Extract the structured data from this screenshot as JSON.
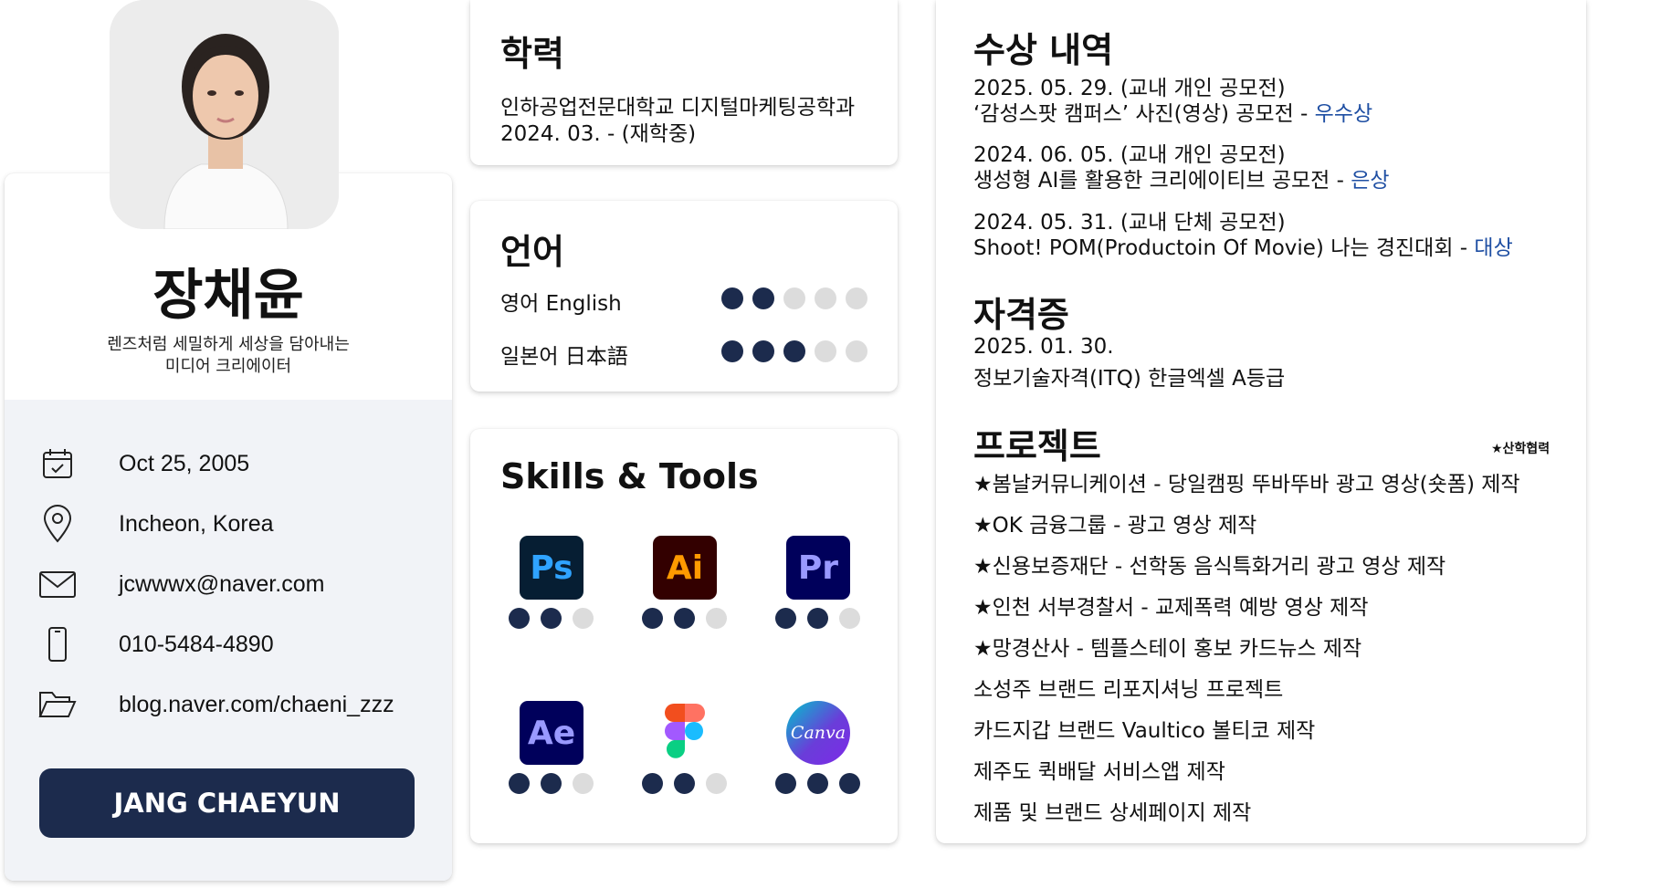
{
  "profile": {
    "name": "장채윤",
    "tagline_line1": "렌즈처럼 세밀하게 세상을 담아내는",
    "tagline_line2": "미디어 크리에이터",
    "contacts": [
      {
        "icon": "calendar-icon",
        "text": "Oct 25, 2005"
      },
      {
        "icon": "location-pin-icon",
        "text": "Incheon, Korea"
      },
      {
        "icon": "mail-icon",
        "text": "jcwwwx@naver.com"
      },
      {
        "icon": "phone-icon",
        "text": "010-5484-4890"
      },
      {
        "icon": "folder-icon",
        "text": "blog.naver.com/chaeni_zzz"
      }
    ],
    "button_label": "JANG CHAEYUN"
  },
  "education": {
    "title": "학력",
    "line1": "인하공업전문대학교 디지털마케팅공학과",
    "line2": "2024. 03. - (재학중)"
  },
  "language": {
    "title": "언어",
    "items": [
      {
        "label": "영어 English",
        "level": 2,
        "max": 5
      },
      {
        "label": "일본어 日本語",
        "level": 3,
        "max": 5
      }
    ]
  },
  "skills": {
    "title": "Skills & Tools",
    "tools": [
      {
        "icon": "photoshop-icon",
        "abbr": "Ps",
        "level": 2,
        "max": 3
      },
      {
        "icon": "illustrator-icon",
        "abbr": "Ai",
        "level": 2,
        "max": 3
      },
      {
        "icon": "premiere-icon",
        "abbr": "Pr",
        "level": 2,
        "max": 3
      },
      {
        "icon": "after-effects-icon",
        "abbr": "Ae",
        "level": 2,
        "max": 3
      },
      {
        "icon": "figma-icon",
        "abbr": "",
        "level": 2,
        "max": 3
      },
      {
        "icon": "canva-icon",
        "abbr": "Canva",
        "level": 3,
        "max": 3
      }
    ]
  },
  "awards": {
    "title": "수상 내역",
    "items": [
      {
        "date": "2025. 05. 29. (교내 개인 공모전)",
        "desc": "‘감성스팟 캠퍼스’ 사진(영상) 공모전 - ",
        "prize": "우수상"
      },
      {
        "date": "2024. 06. 05. (교내 개인 공모전)",
        "desc": "생성형 AI를 활용한 크리에이티브 공모전 - ",
        "prize": "은상"
      },
      {
        "date": "2024. 05. 31. (교내 단체 공모전)",
        "desc": "Shoot! POM(Productoin Of Movie) 나는 경진대회 - ",
        "prize": "대상"
      }
    ]
  },
  "certificate": {
    "title": "자격증",
    "date": "2025. 01. 30.",
    "name": "정보기술자격(ITQ) 한글엑셀 A등급"
  },
  "projects": {
    "title": "프로젝트",
    "note": "★산학협력",
    "items": [
      "★봄날커뮤니케이션 - 당일캠핑 뚜바뚜바 광고 영상(숏폼) 제작",
      "★OK 금융그룹 - 광고 영상 제작",
      "★신용보증재단 - 선학동 음식특화거리 광고 영상 제작",
      "★인천 서부경찰서 - 교제폭력 예방 영상 제작",
      "★망경산사 - 템플스테이 홍보 카드뉴스 제작",
      "소성주 브랜드 리포지셔닝 프로젝트",
      "카드지갑 브랜드 Vaultico 볼티코 제작",
      "제주도 퀵배달 서비스앱 제작",
      "제품 및 브랜드 상세페이지 제작"
    ]
  },
  "colors": {
    "accent": "#1c2b4d",
    "link": "#1f4fa3",
    "dot_off": "#dcdcdc"
  }
}
